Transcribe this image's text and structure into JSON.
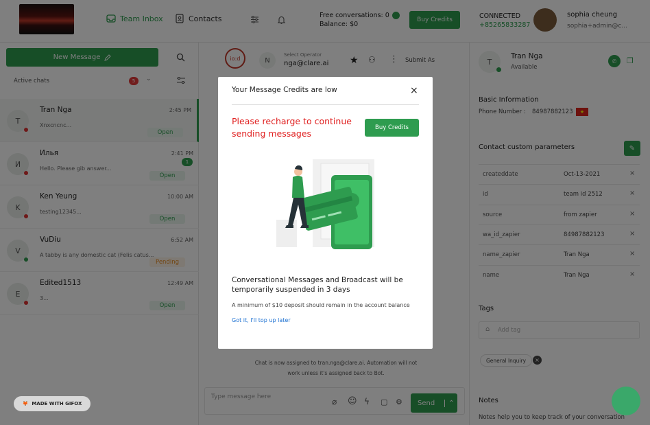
{
  "topbar": {
    "team_inbox": "Team Inbox",
    "contacts": "Contacts",
    "free_conversations": "Free conversations: 0",
    "balance": "Balance: $0",
    "buy_credits": "Buy Credits",
    "connected": "CONNECTED",
    "phone": "+85265833287",
    "user_name": "sophia cheung",
    "user_email": "sophia+admin@c..."
  },
  "sidebar": {
    "new_message": "New Message",
    "active_chats": "Active chats",
    "active_count": "5",
    "chats": [
      {
        "initial": "T",
        "name": "Tran Nga",
        "time": "2:45 PM",
        "preview": "Xnxcncnc...",
        "status": "Open"
      },
      {
        "initial": "И",
        "name": "Илья",
        "time": "2:41 PM",
        "preview": "Hello. Please gib answer...",
        "status": "Open",
        "badge": "1"
      },
      {
        "initial": "K",
        "name": "Ken Yeung",
        "time": "10:00 AM",
        "preview": "testing12345...",
        "status": "Open"
      },
      {
        "initial": "V",
        "name": "VuDiu",
        "time": "6:52 AM",
        "preview": "A tabby is any domestic cat (Felis catus...",
        "status": "Pending"
      },
      {
        "initial": "E",
        "name": "Edited1513",
        "time": "12:49 AM",
        "preview": "3...",
        "status": "Open"
      }
    ]
  },
  "chat_header": {
    "select_operator": "Select Operator",
    "operator": "nga@clare.ai",
    "operator_initial": "N",
    "submit_as": "Submit As"
  },
  "chat": {
    "notice": "Chat is now assigned to tran.nga@clare.ai. Automation will not work unless it's assigned back to Bot.",
    "input_placeholder": "Type message here",
    "send": "Send"
  },
  "contact": {
    "initial": "T",
    "name": "Tran Nga",
    "status": "Available",
    "basic_info": "Basic Information",
    "phone_label": "Phone Number :",
    "phone": "84987882123",
    "custom_params_title": "Contact custom parameters",
    "params": [
      {
        "key": "createddate",
        "value": "Oct-13-2021"
      },
      {
        "key": "id",
        "value": "team id 2512"
      },
      {
        "key": "source",
        "value": "from zapier"
      },
      {
        "key": "wa_id_zapier",
        "value": "84987882123"
      },
      {
        "key": "name_zapier",
        "value": "Tran Nga"
      },
      {
        "key": "name",
        "value": "Tran Nga"
      }
    ],
    "tags_title": "Tags",
    "tag_placeholder": "Add tag",
    "tag": "General Inquiry",
    "notes_title": "Notes",
    "notes_text": "Notes help you to keep track of your conversation"
  },
  "modal": {
    "title": "Your Message Credits are low",
    "red_text": "Please recharge to continue sending messages",
    "buy": "Buy Credits",
    "heading": "Conversational Messages and Broadcast will be temporarily suspended in 3 days",
    "sub": "A minimum of $10 deposit should remain in the account balance",
    "link": "Got it, I'll top up later"
  },
  "gifox": "MADE WITH GIFOX",
  "colors": {
    "accent": "#2e9c4f",
    "alert": "#e02020",
    "link": "#1a6fd1"
  }
}
